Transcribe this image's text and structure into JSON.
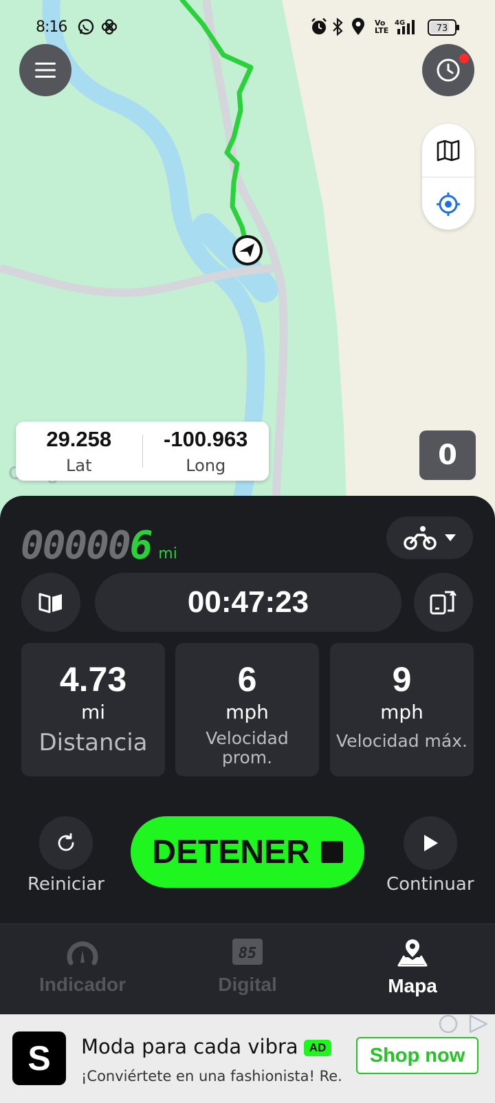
{
  "status_bar": {
    "time": "8:16",
    "battery": "73",
    "left_icons": [
      "whatsapp-icon",
      "pinwheel-icon"
    ],
    "right_icons": [
      "alarm-icon",
      "bluetooth-icon",
      "location-icon",
      "volte-icon",
      "signal-4g-icon",
      "battery-icon"
    ]
  },
  "map": {
    "menu_icon": "hamburger-icon",
    "history_icon": "clock-icon",
    "tools": [
      "map-layers-icon",
      "my-location-icon"
    ],
    "coordinates": {
      "lat_value": "29.258",
      "lat_label": "Lat",
      "long_value": "-100.963",
      "long_label": "Long"
    },
    "counter": "0",
    "google": "Google",
    "track_color": "#2ad13a"
  },
  "panel": {
    "odometer": {
      "digits": "00000",
      "last_digit": "6",
      "unit": "mi"
    },
    "vehicle_icon": "bicycle-icon",
    "timer": "00:47:23",
    "stats": [
      {
        "value": "4.73",
        "unit": "mi",
        "label": "Distancia"
      },
      {
        "value": "6",
        "unit": "mph",
        "label": "Velocidad prom."
      },
      {
        "value": "9",
        "unit": "mph",
        "label": "Velocidad máx."
      }
    ],
    "actions": {
      "reset_label": "Reiniciar",
      "stop_label": "DETENER",
      "continue_label": "Continuar"
    },
    "accent": "#1ff51f"
  },
  "nav": {
    "items": [
      {
        "label": "Indicador",
        "icon": "speedometer-icon",
        "active": false
      },
      {
        "label": "Digital",
        "icon": "digital-display-icon",
        "active": false
      },
      {
        "label": "Mapa",
        "icon": "map-pin-icon",
        "active": true
      }
    ]
  },
  "ad": {
    "logo": "S",
    "title": "Moda para cada vibra",
    "badge": "AD",
    "subtitle": "¡Conviértete en una fashionista! Re...",
    "cta": "Shop now"
  }
}
